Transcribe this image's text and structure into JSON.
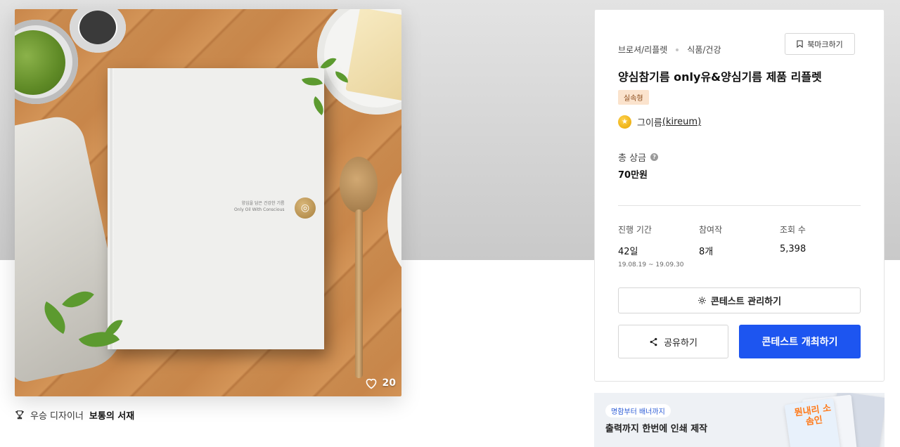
{
  "hero": {
    "likes": "20",
    "book_text_line1": "양심을 담은 건강한 기름",
    "book_text_line2": "Only Oil With Conscious"
  },
  "designer": {
    "prefix": "우승 디자이너",
    "name": "보통의 서재"
  },
  "contest": {
    "category": "브로셔/리플렛",
    "subcategory": "식품/건강",
    "bookmark_label": "북마크하기",
    "title": "양심참기름 only유&양심기름 제품 리플렛",
    "badge": "실속형",
    "host_name": "그이름",
    "host_handle": "(kireum)",
    "prize_label": "총 상금",
    "prize_value": "70만원",
    "stats": [
      {
        "label": "진행 기간",
        "value": "42일",
        "sub": "19.08.19 ~ 19.09.30"
      },
      {
        "label": "참여작",
        "value": "8개"
      },
      {
        "label": "조회 수",
        "value": "5,398"
      }
    ],
    "manage_label": "콘테스트 관리하기",
    "share_label": "공유하기",
    "host_button_label": "콘테스트 개최하기"
  },
  "banner": {
    "pill": "명함부터 배너까지",
    "headline": "출력까지 한번에 인쇄 제작",
    "promo_text": "뭔내리 소솜인"
  },
  "colors": {
    "accent": "#1d55f0",
    "badge_bg": "#fbe3cd"
  }
}
